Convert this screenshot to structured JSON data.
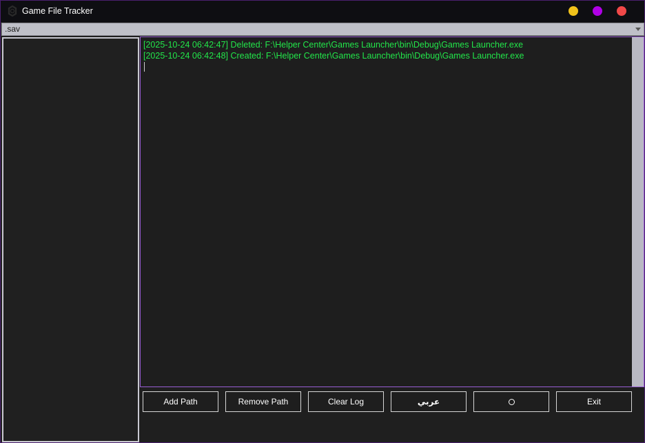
{
  "window": {
    "title": "Game File Tracker",
    "icon": "app-logo-icon",
    "controls": {
      "minimize_color": "#f1c21b",
      "maximize_color": "#b000e6",
      "close_color": "#f04848"
    }
  },
  "filter": {
    "selected": ".sav"
  },
  "paths": {
    "items": []
  },
  "log": {
    "text_color": "#22e64a",
    "lines": [
      "[2025-10-24 06:42:47] Deleted: F:\\Helper Center\\Games Launcher\\bin\\Debug\\Games Launcher.exe",
      "[2025-10-24 06:42:48] Created: F:\\Helper Center\\Games Launcher\\bin\\Debug\\Games Launcher.exe"
    ]
  },
  "buttons": {
    "add_path": "Add Path",
    "remove_path": "Remove Path",
    "clear_log": "Clear Log",
    "language": "عربي",
    "theme_icon": "circle-icon",
    "exit": "Exit"
  }
}
